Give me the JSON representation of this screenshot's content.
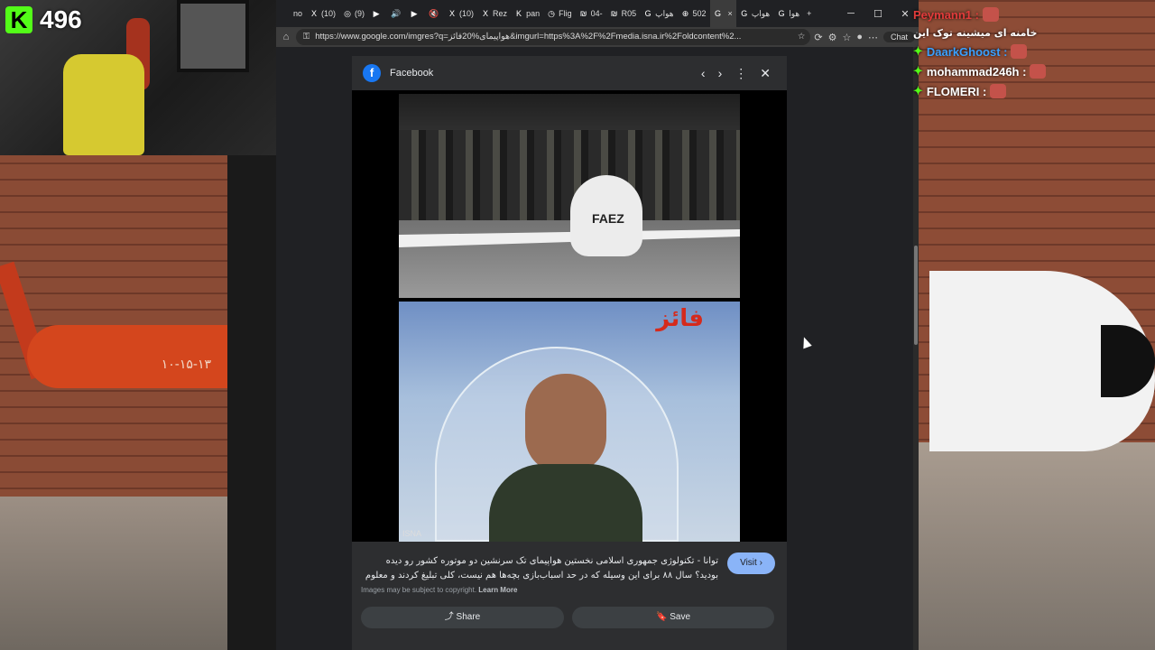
{
  "overlay": {
    "kick_count": "496"
  },
  "browser": {
    "tabs": [
      {
        "label": "no",
        "icon": ""
      },
      {
        "label": "(10)",
        "icon": "X"
      },
      {
        "label": "(9)",
        "icon": "◎"
      },
      {
        "label": "",
        "icon": "▶"
      },
      {
        "label": "",
        "icon": "🔊"
      },
      {
        "label": "",
        "icon": "▶"
      },
      {
        "label": "",
        "icon": "🔇"
      },
      {
        "label": "(10)",
        "icon": "X"
      },
      {
        "label": "Rez",
        "icon": "X"
      },
      {
        "label": "pan",
        "icon": "K"
      },
      {
        "label": "Flig",
        "icon": "◷"
      },
      {
        "label": "04-",
        "icon": "₪"
      },
      {
        "label": "R05",
        "icon": "₪"
      },
      {
        "label": "هواپ",
        "icon": "G"
      },
      {
        "label": "502",
        "icon": "⊕"
      },
      {
        "label": "",
        "icon": "G",
        "active": true,
        "close": "×"
      },
      {
        "label": "هواپ",
        "icon": "G"
      },
      {
        "label": "هوا",
        "icon": "G"
      }
    ],
    "new_tab": "+",
    "window_controls": [
      "─",
      "☐",
      "✕"
    ],
    "url": "https://www.google.com/imgres?q=هواپیمای%20فائز&imgurl=https%3A%2F%2Fmedia.isna.ir%2Foldcontent%2...",
    "chat_button": "Chat"
  },
  "panel": {
    "source": "Facebook",
    "image_labels": {
      "plane_text": "FAEZ",
      "title_fa": "فائز",
      "watermark": "ISNA"
    },
    "caption": "توانا - تکنولوژی جمهوری اسلامی نخستین هواپیمای تک سرنشین دو موتوره کشور رو دیده بودید؟ سال ۸۸ برای این وسیله که در حد اسباب‌بازی بچه‌ها هم نیست، کلی تبلیغ کردند و معلوم",
    "visit_label": "Visit",
    "copyright": "Images may be subject to copyright.",
    "learn_more": "Learn More",
    "share_label": "Share",
    "save_label": "Save"
  },
  "chat": [
    {
      "user": "Peymann1",
      "text": ""
    },
    {
      "user": "",
      "text": "خامنه ای میشینه توک این"
    },
    {
      "user": "DaarkGhoost",
      "text": ""
    },
    {
      "user": "mohammad246h",
      "text": ""
    },
    {
      "user": "FLOMERI",
      "text": ""
    }
  ],
  "colors": {
    "kick_green": "#53fc18",
    "google_blue": "#8ab4f8",
    "facebook_blue": "#1877f2"
  }
}
